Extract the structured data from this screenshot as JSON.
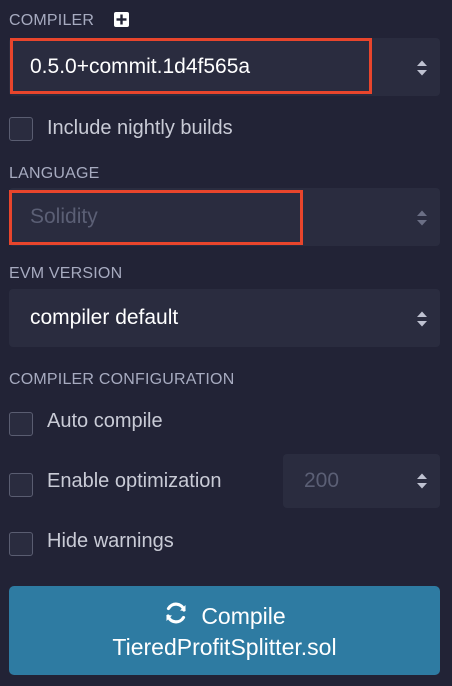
{
  "compiler": {
    "section_label": "COMPILER",
    "add_icon": "plus-square-icon",
    "selected_version": "0.5.0+commit.1d4f565a",
    "nightly_label": "Include nightly builds"
  },
  "language": {
    "section_label": "LANGUAGE",
    "selected": "Solidity"
  },
  "evm": {
    "section_label": "EVM VERSION",
    "selected": "compiler default"
  },
  "config": {
    "section_label": "COMPILER CONFIGURATION",
    "auto_compile_label": "Auto compile",
    "optimization_label": "Enable optimization",
    "runs_value": "200",
    "hide_warnings_label": "Hide warnings"
  },
  "compile_button": {
    "icon": "sync-icon",
    "label": "Compile",
    "filename": "TieredProfitSplitter.sol"
  },
  "colors": {
    "background": "#222336",
    "field": "#2a2c3f",
    "highlight": "#e8452c",
    "button": "#2e7ba2"
  }
}
